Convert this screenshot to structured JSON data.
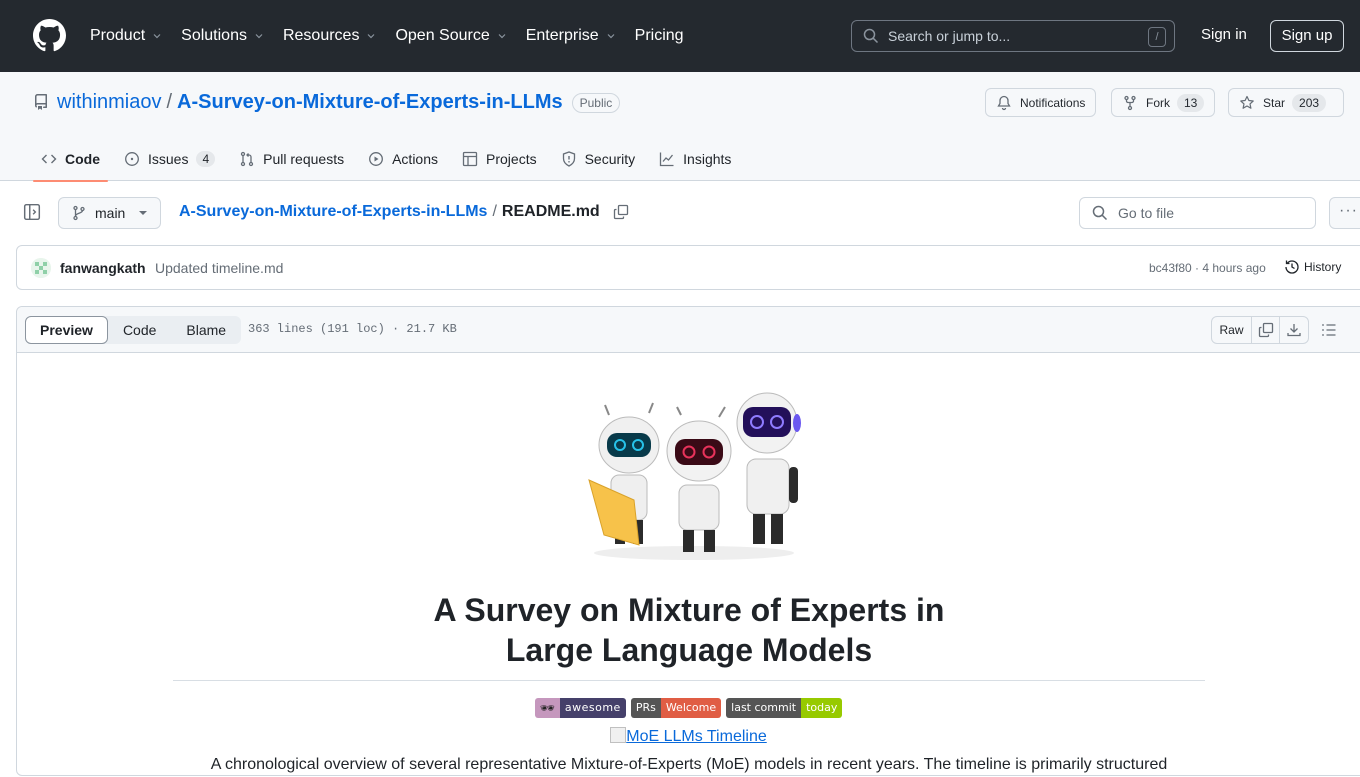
{
  "topnav": {
    "items": [
      {
        "label": "Product",
        "dropdown": true
      },
      {
        "label": "Solutions",
        "dropdown": true
      },
      {
        "label": "Resources",
        "dropdown": true
      },
      {
        "label": "Open Source",
        "dropdown": true
      },
      {
        "label": "Enterprise",
        "dropdown": true
      },
      {
        "label": "Pricing",
        "dropdown": false
      }
    ],
    "search_placeholder": "Search or jump to...",
    "search_shortcut": "/",
    "signin": "Sign in",
    "signup": "Sign up"
  },
  "repo": {
    "owner": "withinmiaov",
    "separator": "/",
    "name": "A-Survey-on-Mixture-of-Experts-in-LLMs",
    "visibility": "Public",
    "notifications_label": "Notifications",
    "fork_label": "Fork",
    "fork_count": "13",
    "star_label": "Star",
    "star_count": "203"
  },
  "tabs": [
    {
      "label": "Code",
      "icon": "code-icon",
      "active": true
    },
    {
      "label": "Issues",
      "icon": "issue-icon",
      "count": "4"
    },
    {
      "label": "Pull requests",
      "icon": "pull-request-icon"
    },
    {
      "label": "Actions",
      "icon": "play-icon"
    },
    {
      "label": "Projects",
      "icon": "table-icon"
    },
    {
      "label": "Security",
      "icon": "shield-icon"
    },
    {
      "label": "Insights",
      "icon": "graph-icon"
    }
  ],
  "filenav": {
    "branch": "main",
    "crumb_repo": "A-Survey-on-Mixture-of-Experts-in-LLMs",
    "crumb_sep": "/",
    "file": "README.md",
    "gofile_placeholder": "Go to file",
    "more": "···"
  },
  "commit": {
    "author": "fanwangkath",
    "message": "Updated timeline.md",
    "sha_time": "bc43f80 · 4 hours ago",
    "history": "History"
  },
  "file": {
    "views": [
      "Preview",
      "Code",
      "Blame"
    ],
    "active_view": "Preview",
    "meta": "363 lines (191 loc) · 21.7 KB",
    "raw": "Raw"
  },
  "readme": {
    "title_line1": "A Survey on Mixture of Experts in",
    "title_line2": "Large Language Models",
    "badges": [
      {
        "left": "🕶",
        "right": "awesome",
        "left_color": "#c597bd",
        "right_color": "#45406a"
      },
      {
        "left": "PRs",
        "right": "Welcome",
        "left_color": "#555555",
        "right_color": "#e05d44"
      },
      {
        "left": "last commit",
        "right": "today",
        "left_color": "#555555",
        "right_color": "#97ca00"
      }
    ],
    "timeline_alt": "MoE LLMs Timeline",
    "paragraph": "A chronological overview of several representative Mixture-of-Experts (MoE) models in recent years. The timeline is primarily structured"
  },
  "colors": {
    "header_bg": "#24292f",
    "link": "#0969da",
    "active_tab_underline": "#fd8c73"
  }
}
